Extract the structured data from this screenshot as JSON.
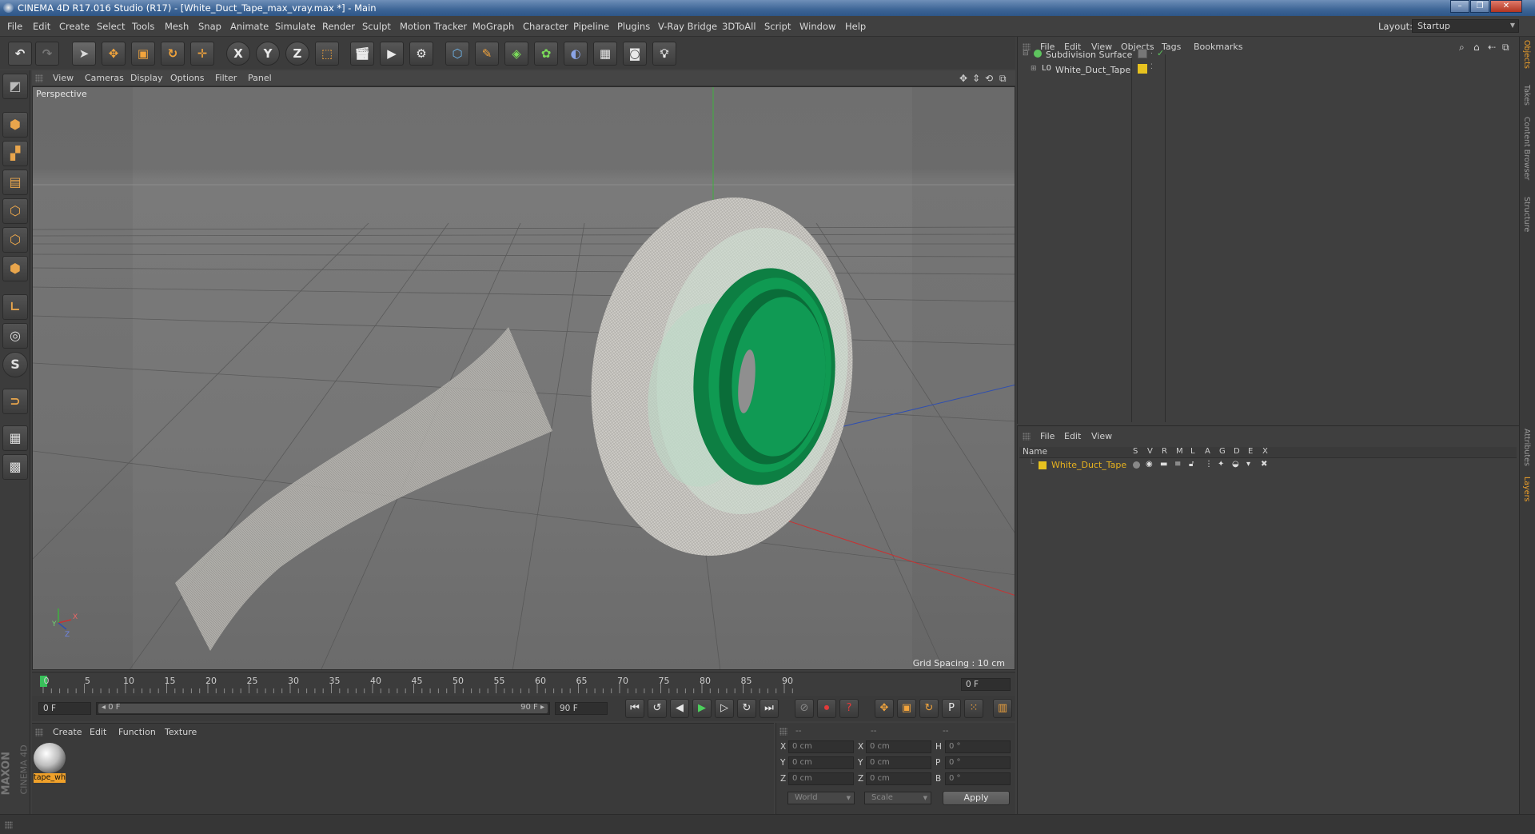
{
  "window": {
    "title": "CINEMA 4D R17.016 Studio (R17) - [White_Duct_Tape_max_vray.max *] - Main",
    "controls": [
      "–",
      "❐",
      "✕"
    ]
  },
  "menubar": {
    "items": [
      "File",
      "Edit",
      "Create",
      "Select",
      "Tools",
      "Mesh",
      "Snap",
      "Animate",
      "Simulate",
      "Render",
      "Sculpt",
      "Motion Tracker",
      "MoGraph",
      "Character",
      "Pipeline",
      "Plugins",
      "V-Ray Bridge",
      "3DToAll",
      "Script",
      "Window",
      "Help"
    ],
    "layout_label": "Layout:",
    "layout_value": "Startup"
  },
  "toolbar": {
    "undo": "↶",
    "redo": "↷",
    "select": "➤",
    "move": "✥",
    "scale": "▣",
    "rotate": "↻",
    "add": "✛",
    "axis_x": "X",
    "axis_y": "Y",
    "axis_z": "Z",
    "coord": "⬚"
  },
  "viewport": {
    "menu": [
      "View",
      "Cameras",
      "Display",
      "Options",
      "Filter",
      "Panel"
    ],
    "label": "Perspective",
    "grid_spacing": "Grid Spacing : 10 cm",
    "axis_y": "Y",
    "axis_x": "X",
    "axis_z": "Z"
  },
  "timeline": {
    "ticks": [
      "0",
      "5",
      "10",
      "15",
      "20",
      "25",
      "30",
      "35",
      "40",
      "45",
      "50",
      "55",
      "60",
      "65",
      "70",
      "75",
      "80",
      "85",
      "90"
    ],
    "frame_display": "0 F",
    "start_field": "0 F",
    "range_start": "◂ 0 F",
    "range_end": "90 F ▸",
    "end_field": "90 F"
  },
  "material_manager": {
    "menu": [
      "Create",
      "Edit",
      "Function",
      "Texture"
    ],
    "material_name": "tape_wh",
    "brand_top": "MAXON",
    "brand_bottom": "CINEMA 4D"
  },
  "coordinates": {
    "header": [
      "--",
      "--",
      "--"
    ],
    "rows": [
      {
        "pos_label": "X",
        "pos_value": "0 cm",
        "size_label": "X",
        "size_value": "0 cm",
        "rot_label": "H",
        "rot_value": "0 °"
      },
      {
        "pos_label": "Y",
        "pos_value": "0 cm",
        "size_label": "Y",
        "size_value": "0 cm",
        "rot_label": "P",
        "rot_value": "0 °"
      },
      {
        "pos_label": "Z",
        "pos_value": "0 cm",
        "size_label": "Z",
        "size_value": "0 cm",
        "rot_label": "B",
        "rot_value": "0 °"
      }
    ],
    "world_select": "World",
    "scale_select": "Scale",
    "apply": "Apply"
  },
  "object_manager": {
    "menu": [
      "File",
      "Edit",
      "View",
      "Objects",
      "Tags",
      "Bookmarks"
    ],
    "objects": [
      {
        "name": "Subdivision Surface",
        "color": "#5ec45e"
      },
      {
        "name": "White_Duct_Tape",
        "color": "#d8d8d8"
      }
    ]
  },
  "layer_manager": {
    "menu": [
      "File",
      "Edit",
      "View"
    ],
    "columns": [
      "Name",
      "S",
      "V",
      "R",
      "M",
      "L",
      "A",
      "G",
      "D",
      "E",
      "X"
    ],
    "layers": [
      {
        "name": "White_Duct_Tape",
        "color": "#e7c21f"
      }
    ]
  },
  "right_tabs": [
    "Objects",
    "Takes",
    "Content Browser",
    "Structure",
    "Attributes",
    "Layers"
  ],
  "colors": {
    "accent_orange": "#f2a43c",
    "layer_yellow": "#e7c21f",
    "tape_green": "#0f8a4a",
    "axis_red": "#c83232",
    "axis_blue": "#2f4fb0",
    "axis_green": "#3fb03f"
  }
}
